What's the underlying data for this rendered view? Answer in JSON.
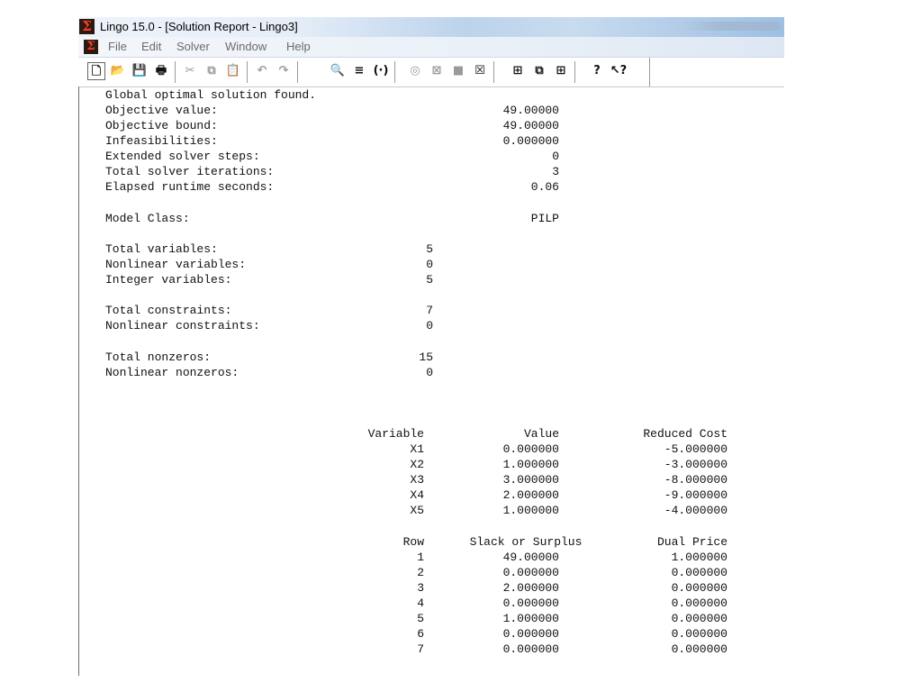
{
  "window": {
    "title": "Lingo 15.0 - [Solution Report - Lingo3]",
    "icon": "lingo-sigma-icon"
  },
  "menu": {
    "items": [
      {
        "id": "file",
        "label": "File"
      },
      {
        "id": "edit",
        "label": "Edit"
      },
      {
        "id": "solver",
        "label": "Solver"
      },
      {
        "id": "window",
        "label": "Window"
      },
      {
        "id": "help",
        "label": "Help"
      }
    ]
  },
  "toolbar": {
    "buttons": [
      {
        "name": "new-file-icon",
        "glyph": "🗋",
        "enabled": true
      },
      {
        "name": "open-folder-icon",
        "glyph": "📂",
        "enabled": true
      },
      {
        "name": "save-icon",
        "glyph": "💾",
        "enabled": true
      },
      {
        "name": "print-icon",
        "glyph": "🖶",
        "enabled": true
      },
      {
        "name": "cut-icon",
        "glyph": "✂",
        "enabled": false
      },
      {
        "name": "copy-icon",
        "glyph": "⧉",
        "enabled": false
      },
      {
        "name": "paste-icon",
        "glyph": "📋",
        "enabled": true
      },
      {
        "name": "undo-icon",
        "glyph": "↶",
        "enabled": false
      },
      {
        "name": "redo-icon",
        "glyph": "↷",
        "enabled": false
      },
      {
        "name": "find-icon",
        "glyph": "🔍",
        "enabled": true
      },
      {
        "name": "goto-line-icon",
        "glyph": "≡",
        "enabled": true
      },
      {
        "name": "match-parenthesis-icon",
        "glyph": "(·)",
        "enabled": true
      },
      {
        "name": "solve-icon",
        "glyph": "◎",
        "enabled": false
      },
      {
        "name": "close-solution-icon",
        "glyph": "⊠",
        "enabled": false
      },
      {
        "name": "send-to-back-icon",
        "glyph": "■",
        "enabled": false
      },
      {
        "name": "close-all-icon",
        "glyph": "☒",
        "enabled": true
      },
      {
        "name": "tile-icon",
        "glyph": "⊞",
        "enabled": true
      },
      {
        "name": "cascade-icon",
        "glyph": "⧉",
        "enabled": true
      },
      {
        "name": "grid-icon",
        "glyph": "⊞",
        "enabled": true
      },
      {
        "name": "help-icon",
        "glyph": "?",
        "enabled": true
      },
      {
        "name": "context-help-icon",
        "glyph": "↖?",
        "enabled": true
      }
    ]
  },
  "report": {
    "summary": [
      {
        "label": "Global optimal solution found.",
        "value": ""
      },
      {
        "label": "Objective value:",
        "value": "49.00000"
      },
      {
        "label": "Objective bound:",
        "value": "49.00000"
      },
      {
        "label": "Infeasibilities:",
        "value": "0.000000"
      },
      {
        "label": "Extended solver steps:",
        "value": "0"
      },
      {
        "label": "Total solver iterations:",
        "value": "3"
      },
      {
        "label": "Elapsed runtime seconds:",
        "value": "0.06"
      }
    ],
    "model_class": {
      "label": "Model Class:",
      "value": "PILP"
    },
    "counts": [
      {
        "label": "Total variables:",
        "value": "5"
      },
      {
        "label": "Nonlinear variables:",
        "value": "0"
      },
      {
        "label": "Integer variables:",
        "value": "5"
      },
      {
        "label": "Total constraints:",
        "value": "7"
      },
      {
        "label": "Nonlinear constraints:",
        "value": "0"
      },
      {
        "label": "Total nonzeros:",
        "value": "15"
      },
      {
        "label": "Nonlinear nonzeros:",
        "value": "0"
      }
    ],
    "variables_table": {
      "headers": [
        "Variable",
        "Value",
        "Reduced Cost"
      ],
      "rows": [
        [
          "X1",
          "0.000000",
          "-5.000000"
        ],
        [
          "X2",
          "1.000000",
          "-3.000000"
        ],
        [
          "X3",
          "3.000000",
          "-8.000000"
        ],
        [
          "X4",
          "2.000000",
          "-9.000000"
        ],
        [
          "X5",
          "1.000000",
          "-4.000000"
        ]
      ]
    },
    "rows_table": {
      "headers": [
        "Row",
        "Slack or Surplus",
        "Dual Price"
      ],
      "rows": [
        [
          "1",
          "49.00000",
          "1.000000"
        ],
        [
          "2",
          "0.000000",
          "0.000000"
        ],
        [
          "3",
          "2.000000",
          "0.000000"
        ],
        [
          "4",
          "0.000000",
          "0.000000"
        ],
        [
          "5",
          "1.000000",
          "0.000000"
        ],
        [
          "6",
          "0.000000",
          "0.000000"
        ],
        [
          "7",
          "0.000000",
          "0.000000"
        ]
      ]
    }
  }
}
